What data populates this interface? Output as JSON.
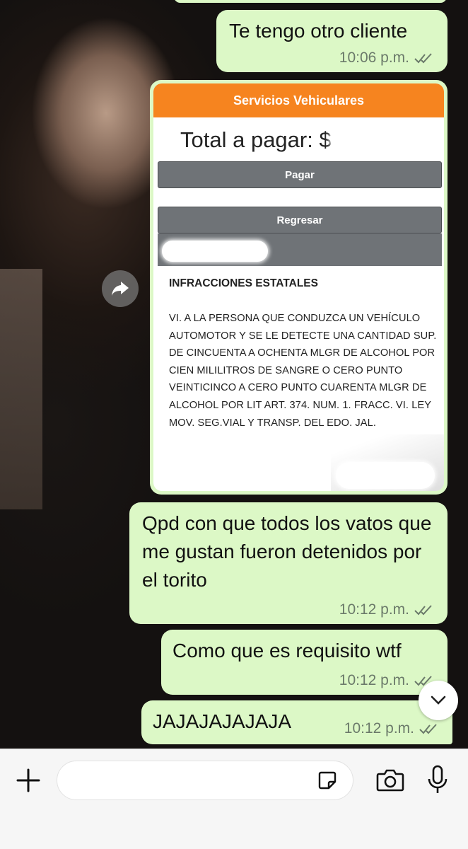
{
  "messages": [
    {
      "text": "Te tengo otro cliente",
      "time": "10:06 p.m."
    },
    {
      "text": "Qpd con que todos los vatos que me gustan fueron detenidos por el torito",
      "time": "10:12 p.m."
    },
    {
      "text": "Como que es requisito wtf",
      "time": "10:12 p.m."
    },
    {
      "text": "JAJAJAJAJAJA",
      "time": "10:12 p.m."
    }
  ],
  "image_message": {
    "header": "Servicios Vehiculares",
    "total_label": "Total a pagar: $",
    "pay_button": "Pagar",
    "back_button": "Regresar",
    "section_title": "INFRACCIONES ESTATALES",
    "body_text": "VI. A LA PERSONA QUE CONDUZCA UN VEHÍCULO AUTOMOTOR Y SE LE DETECTE UNA CANTIDAD SUP. DE CINCUENTA A OCHENTA MLGR DE ALCOHOL POR CIEN MILILITROS DE SANGRE O CERO PUNTO VEINTICINCO A CERO PUNTO CUARENTA MLGR DE ALCOHOL POR LIT ART. 374. NUM. 1. FRACC. VI. LEY MOV. SEG.VIAL Y TRANSP. DEL EDO. JAL."
  },
  "icons": {
    "forward": "forward-icon",
    "scroll_down": "chevron-down-icon",
    "attach": "plus-icon",
    "sticker": "sticker-icon",
    "camera": "camera-icon",
    "mic": "microphone-icon",
    "read": "double-check-icon"
  },
  "colors": {
    "outgoing_bubble": "#dcf8c6",
    "header_orange": "#f6841f",
    "read_ticks": "#6b7a6a"
  }
}
